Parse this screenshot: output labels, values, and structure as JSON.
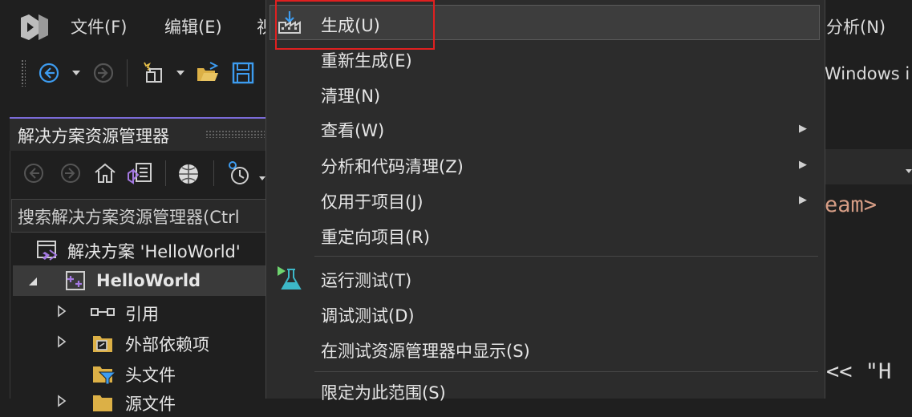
{
  "menubar": {
    "items": [
      {
        "label": "文件(F)"
      },
      {
        "label": "编辑(E)"
      },
      {
        "label": "视"
      },
      {
        "label": "分析(N)"
      }
    ]
  },
  "toolbar": {
    "platform_text": "Windows i"
  },
  "solution_explorer": {
    "title": "解决方案资源管理器",
    "search_placeholder": "搜索解决方案资源管理器(Ctrl",
    "tree": {
      "solution": "解决方案 'HelloWorld'",
      "project": "HelloWorld",
      "references": "引用",
      "external_deps": "外部依赖项",
      "headers": "头文件",
      "sources": "源文件"
    }
  },
  "context_menu": {
    "items": [
      {
        "label": "生成(U)",
        "icon": "build-icon"
      },
      {
        "label": "重新生成(E)"
      },
      {
        "label": "清理(N)"
      },
      {
        "label": "查看(W)",
        "submenu": true
      },
      {
        "label": "分析和代码清理(Z)",
        "submenu": true
      },
      {
        "label": "仅用于项目(J)",
        "submenu": true
      },
      {
        "label": "重定向项目(R)"
      },
      {
        "label": "运行测试(T)",
        "icon": "run-tests-icon"
      },
      {
        "label": "调试测试(D)"
      },
      {
        "label": "在测试资源管理器中显示(S)"
      },
      {
        "label": "限定为此范围(S)"
      }
    ]
  },
  "editor": {
    "line1": "eam>",
    "line2": "<<  \"H"
  },
  "colors": {
    "accent": "#7b6bd8",
    "highlight_box": "#e02020",
    "code_string": "#d69d85"
  }
}
